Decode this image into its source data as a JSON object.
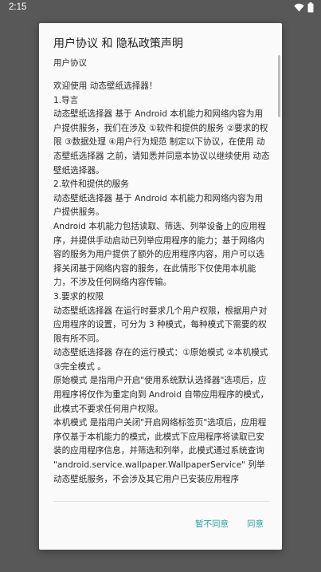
{
  "status_bar": {
    "time": "2:15"
  },
  "dialog": {
    "title": "用户协议 和 隐私政策声明",
    "subtitle": "用户协议",
    "content_lines": [
      "欢迎使用 动态壁纸选择器！",
      "1.导言",
      "动态壁纸选择器 基于 Android 本机能力和网络内容为用户提供服务，我们在涉及 ①软件和提供的服务 ②要求的权限 ③数据处理 ④用户行为规范 制定以下协议，在使用 动态壁纸选择器 之前，请知悉并同意本协议以继续使用 动态壁纸选择器。",
      "2.软件和提供的服务",
      "动态壁纸选择器 基于 Android 本机能力和网络内容为用户提供服务。",
      "Android 本机能力包括读取、筛选、列举设备上的应用程序，并提供手动启动已列举应用程序的能力；基于网络内容的服务为用户提供了额外的应用程序内容，用户可以选择关闭基于网络内容的服务，在此情形下仅使用本机能力，不涉及任何网络内容传输。",
      "3.要求的权限",
      "动态壁纸选择器 在运行时要求几个用户权限，根据用户对应用程序的设置，可分为 3 种模式，每种模式下需要的权限有所不同。",
      "动态壁纸选择器 存在的运行模式：①原始模式 ②本机模式 ③完全模式 。",
      "原始模式 是指用户开启\"使用系统默认选择器\"选项后，应用程序将仅作为重定向到 Android 自带应用程序的模式，此模式不要求任何用户权限。",
      "本机模式 是指用户关闭\"开启网络标签页\"选项后，应用程序仅基于本机能力的模式，此模式下应用程序将读取已安装的应用程序信息，并筛选和列举，此模式通过系统查询 \"android.service.wallpaper.WallpaperService\" 列举动态壁纸服务，不会涉及其它用户已安装应用程序"
    ],
    "decline_label": "暂不同意",
    "agree_label": "同意"
  },
  "colors": {
    "accent": "#26a69a",
    "scrim": "#585858",
    "dialog_bg": "#fafafa"
  },
  "icons": {
    "wifi": "wifi-icon",
    "battery": "battery-icon"
  }
}
